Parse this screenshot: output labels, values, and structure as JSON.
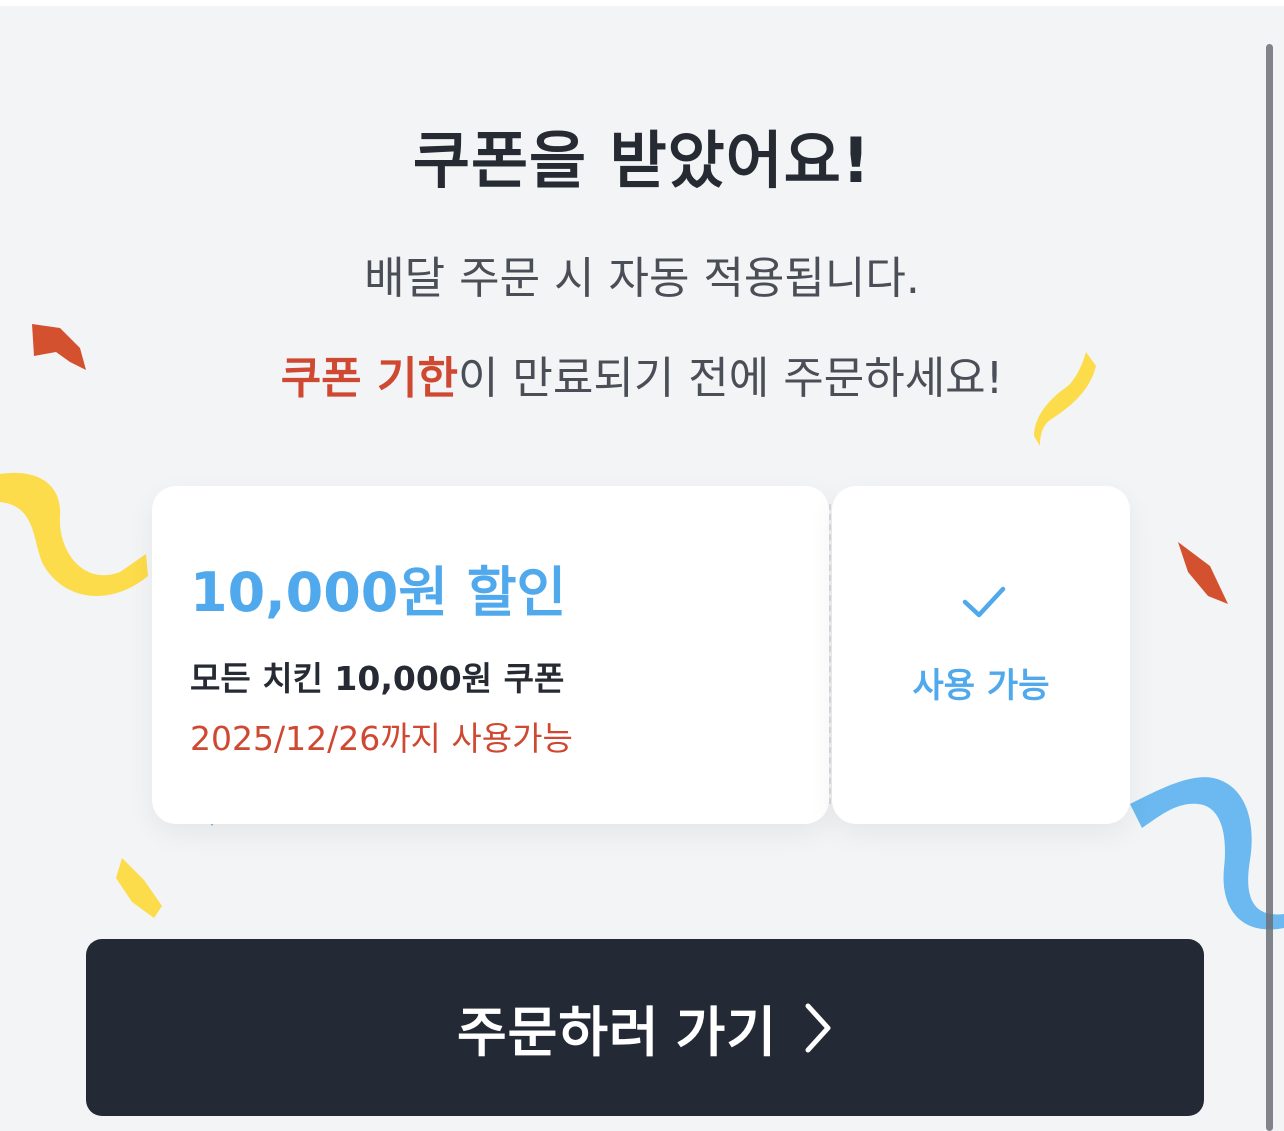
{
  "header": {
    "title": "쿠폰을 받았어요!",
    "subtitle": "배달 주문 시 자동 적용됩니다.",
    "notice_highlight": "쿠폰 기한",
    "notice_rest": "이 만료되기 전에 주문하세요!"
  },
  "coupon": {
    "discount": "10,000원 할인",
    "name": "모든 치킨 10,000원 쿠폰",
    "expiry": "2025/12/26까지 사용가능",
    "status_icon": "check-icon",
    "status_label": "사용 가능"
  },
  "cta": {
    "label": "주문하러 가기",
    "icon": "chevron-right-icon"
  },
  "colors": {
    "background": "#f3f4f6",
    "accent_blue": "#4fa9ec",
    "accent_red": "#cf4832",
    "button_dark": "#232a35",
    "confetti_yellow": "#fcdc4a",
    "confetti_red": "#d4512f",
    "confetti_blue": "#6bb9f0"
  }
}
